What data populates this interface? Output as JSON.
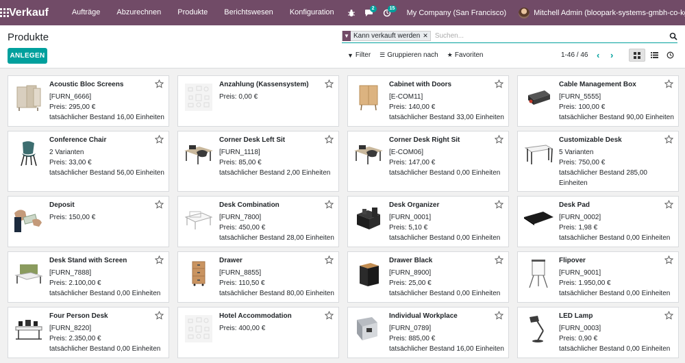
{
  "navbar": {
    "brand": "Verkauf",
    "menu": [
      "Aufträge",
      "Abzurechnen",
      "Produkte",
      "Berichtswesen",
      "Konfiguration"
    ],
    "chat_count": "2",
    "activity_count": "15",
    "company": "My Company (San Francisco)",
    "user": "Mitchell Admin (bloopark-systems-gmbh-co-kg)"
  },
  "control": {
    "title": "Produkte",
    "create_label": "ANLEGEN",
    "facet_label": "Kann verkauft werden",
    "search_placeholder": "Suchen...",
    "filter_label": "Filter",
    "group_label": "Gruppieren nach",
    "favorites_label": "Favoriten",
    "pager": "1-46 / 46"
  },
  "colors": {
    "brand": "#714b67",
    "accent": "#00a09d"
  },
  "products": [
    {
      "name": "Acoustic Bloc Screens",
      "lines": [
        "[FURN_6666]",
        "Preis: 295,00 €",
        "tatsächlicher Bestand 16,00 Einheiten"
      ],
      "image": "screens"
    },
    {
      "name": "Anzahlung (Kassensystem)",
      "lines": [
        "Preis: 0,00 €"
      ],
      "image": "placeholder"
    },
    {
      "name": "Cabinet with Doors",
      "lines": [
        "[E-COM11]",
        "Preis: 140,00 €",
        "tatsächlicher Bestand 33,00 Einheiten"
      ],
      "image": "cabinet"
    },
    {
      "name": "Cable Management Box",
      "lines": [
        "[FURN_5555]",
        "Preis: 100,00 €",
        "tatsächlicher Bestand 90,00 Einheiten"
      ],
      "image": "cablebox"
    },
    {
      "name": "Conference Chair",
      "lines": [
        "2 Varianten",
        "Preis: 33,00 €",
        "tatsächlicher Bestand 56,00 Einheiten"
      ],
      "image": "chair"
    },
    {
      "name": "Corner Desk Left Sit",
      "lines": [
        "[FURN_1118]",
        "Preis: 85,00 €",
        "tatsächlicher Bestand 2,00 Einheiten"
      ],
      "image": "cornerdesk"
    },
    {
      "name": "Corner Desk Right Sit",
      "lines": [
        "[E-COM06]",
        "Preis: 147,00 €",
        "tatsächlicher Bestand 0,00 Einheiten"
      ],
      "image": "cornerdesk"
    },
    {
      "name": "Customizable Desk",
      "lines": [
        "5 Varianten",
        "Preis: 750,00 €",
        "tatsächlicher Bestand 285,00",
        "Einheiten"
      ],
      "image": "desk"
    },
    {
      "name": "Deposit",
      "lines": [
        "Preis: 150,00 €"
      ],
      "image": "deposit"
    },
    {
      "name": "Desk Combination",
      "lines": [
        "[FURN_7800]",
        "Preis: 450,00 €",
        "tatsächlicher Bestand 28,00 Einheiten"
      ],
      "image": "deskcombo"
    },
    {
      "name": "Desk Organizer",
      "lines": [
        "[FURN_0001]",
        "Preis: 5,10 €",
        "tatsächlicher Bestand 0,00 Einheiten"
      ],
      "image": "organizer"
    },
    {
      "name": "Desk Pad",
      "lines": [
        "[FURN_0002]",
        "Preis: 1,98 €",
        "tatsächlicher Bestand 0,00 Einheiten"
      ],
      "image": "deskpad"
    },
    {
      "name": "Desk Stand with Screen",
      "lines": [
        "[FURN_7888]",
        "Preis: 2.100,00 €",
        "tatsächlicher Bestand 0,00 Einheiten"
      ],
      "image": "standscreen"
    },
    {
      "name": "Drawer",
      "lines": [
        "[FURN_8855]",
        "Preis: 110,50 €",
        "tatsächlicher Bestand 80,00 Einheiten"
      ],
      "image": "drawer"
    },
    {
      "name": "Drawer Black",
      "lines": [
        "[FURN_8900]",
        "Preis: 25,00 €",
        "tatsächlicher Bestand 0,00 Einheiten"
      ],
      "image": "drawerblack"
    },
    {
      "name": "Flipover",
      "lines": [
        "[FURN_9001]",
        "Preis: 1.950,00 €",
        "tatsächlicher Bestand 0,00 Einheiten"
      ],
      "image": "flipover"
    },
    {
      "name": "Four Person Desk",
      "lines": [
        "[FURN_8220]",
        "Preis: 2.350,00 €",
        "tatsächlicher Bestand 0,00 Einheiten"
      ],
      "image": "fourdesk"
    },
    {
      "name": "Hotel Accommodation",
      "lines": [
        "Preis: 400,00 €"
      ],
      "image": "placeholder"
    },
    {
      "name": "Individual Workplace",
      "lines": [
        "[FURN_0789]",
        "Preis: 885,00 €",
        "tatsächlicher Bestand 16,00 Einheiten"
      ],
      "image": "workplace"
    },
    {
      "name": "LED Lamp",
      "lines": [
        "[FURN_0003]",
        "Preis: 0,90 €",
        "tatsächlicher Bestand 0,00 Einheiten"
      ],
      "image": "lamp"
    }
  ]
}
